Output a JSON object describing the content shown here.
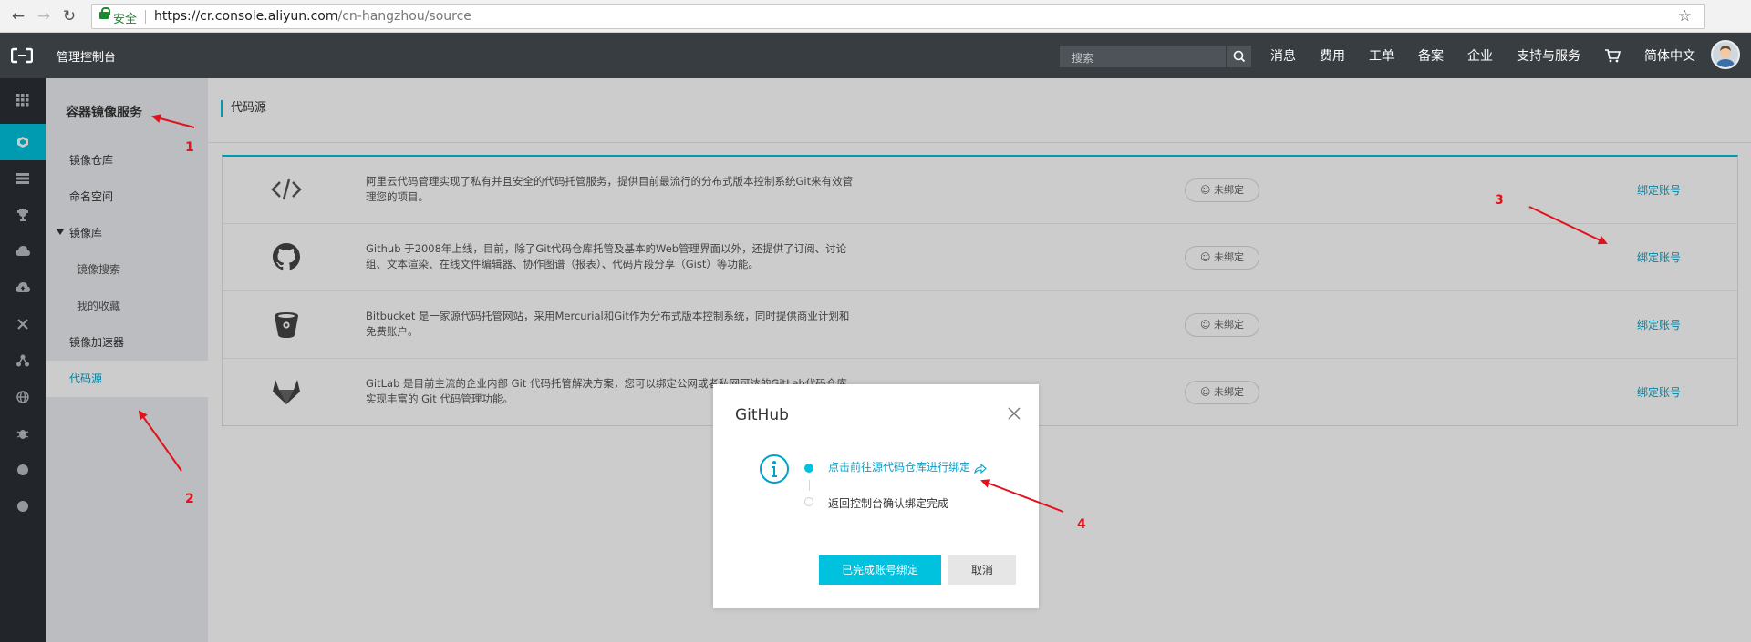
{
  "browser": {
    "secure_label": "安全",
    "url_host": "https://cr.console.aliyun.com",
    "url_path": "/cn-hangzhou/source"
  },
  "topnav": {
    "title": "管理控制台",
    "search_placeholder": "搜索",
    "items": [
      "消息",
      "费用",
      "工单",
      "备案",
      "企业",
      "支持与服务"
    ],
    "language": "简体中文"
  },
  "colors": {
    "accent": "#00c1de",
    "link": "#00a2ca",
    "annotation": "#e0121b",
    "topbar": "#373d41"
  },
  "iconbar": {
    "icons": [
      "grid-icon",
      "container-icon",
      "list-icon",
      "trophy-icon",
      "cloud-icon",
      "cloud-upload-icon",
      "tools-icon",
      "network-icon",
      "globe-icon",
      "bug-icon",
      "dot-icon",
      "dot-icon"
    ]
  },
  "sidebar": {
    "title": "容器镜像服务",
    "items": {
      "repo": "镜像仓库",
      "namespace": "命名空间",
      "library": "镜像库",
      "search": "镜像搜索",
      "favorites": "我的收藏",
      "accelerator": "镜像加速器",
      "source": "代码源"
    }
  },
  "main": {
    "breadcrumb": "代码源",
    "sources": [
      {
        "icon": "code-icon",
        "description": "阿里云代码管理实现了私有并且安全的代码托管服务，提供目前最流行的分布式版本控制系统Git来有效管理您的项目。",
        "status": "未绑定",
        "action": "绑定账号"
      },
      {
        "icon": "github-icon",
        "description": "Github 于2008年上线，目前，除了Git代码仓库托管及基本的Web管理界面以外，还提供了订阅、讨论组、文本渲染、在线文件编辑器、协作图谱（报表）、代码片段分享（Gist）等功能。",
        "status": "未绑定",
        "action": "绑定账号"
      },
      {
        "icon": "bitbucket-icon",
        "description": "Bitbucket 是一家源代码托管网站，采用Mercurial和Git作为分布式版本控制系统，同时提供商业计划和免费账户。",
        "status": "未绑定",
        "action": "绑定账号"
      },
      {
        "icon": "gitlab-icon",
        "description": "GitLab 是目前主流的企业内部 Git 代码托管解决方案，您可以绑定公网或者私网可达的GitLab代码仓库，实现丰富的 Git 代码管理功能。",
        "status": "未绑定",
        "action": "绑定账号"
      }
    ]
  },
  "modal": {
    "title": "GitHub",
    "step1": "点击前往源代码仓库进行绑定",
    "step2": "返回控制台确认绑定完成",
    "confirm": "已完成账号绑定",
    "cancel": "取消"
  },
  "annotations": {
    "labels": [
      "1",
      "2",
      "3",
      "4"
    ]
  }
}
